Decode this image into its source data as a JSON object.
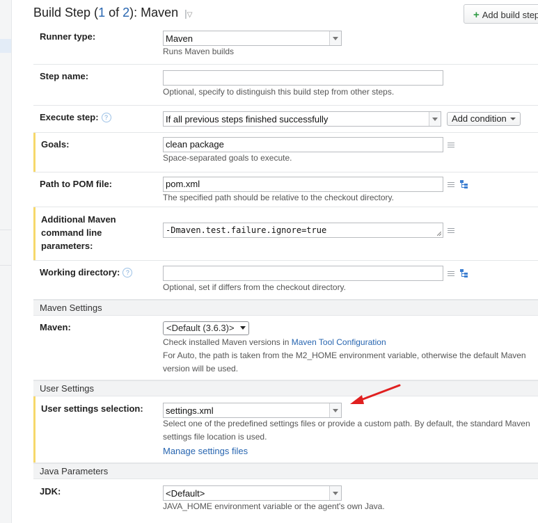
{
  "header": {
    "title_prefix": "Build Step (",
    "step_current": "1",
    "title_of": " of ",
    "step_total": "2",
    "title_suffix": "): Maven",
    "separator": "|",
    "dropdown_glyph": "▽",
    "add_button_label": "Add build step"
  },
  "colors": {
    "link": "#2765b0",
    "highlight_bar": "#f6d86b",
    "annotation_arrow": "#e02020"
  },
  "fields": {
    "runner_type": {
      "label": "Runner type:",
      "value": "Maven",
      "note": "Runs Maven builds"
    },
    "step_name": {
      "label": "Step name:",
      "value": "",
      "note": "Optional, specify to distinguish this build step from other steps."
    },
    "execute_step": {
      "label": "Execute step:",
      "value": "If all previous steps finished successfully",
      "condition_button": "Add condition"
    },
    "goals": {
      "label": "Goals:",
      "value": "clean package",
      "note": "Space-separated goals to execute."
    },
    "pom_path": {
      "label": "Path to POM file:",
      "value": "pom.xml",
      "note": "The specified path should be relative to the checkout directory."
    },
    "additional_params": {
      "label_line1": "Additional Maven",
      "label_line2": "command line",
      "label_line3": "parameters:",
      "value": "-Dmaven.test.failure.ignore=true"
    },
    "working_dir": {
      "label": "Working directory:",
      "value": "",
      "note": "Optional, set if differs from the checkout directory."
    }
  },
  "maven_settings": {
    "section_title": "Maven Settings",
    "maven": {
      "label": "Maven:",
      "value": "<Default (3.6.3)>",
      "note_prefix": "Check installed Maven versions in ",
      "note_link": "Maven Tool Configuration",
      "note2_line1": "For Auto, the path is taken from the M2_HOME environment variable, otherwise the default Maven",
      "note2_line2": "version will be used."
    }
  },
  "user_settings": {
    "section_title": "User Settings",
    "selection": {
      "label": "User settings selection:",
      "value": "settings.xml",
      "note_line1": "Select one of the predefined settings files or provide a custom path. By default, the standard Maven",
      "note_line2": "settings file location is used.",
      "manage_link": "Manage settings files"
    }
  },
  "java_params": {
    "section_title": "Java Parameters",
    "jdk": {
      "label": "JDK:",
      "value": "<Default>",
      "note": "JAVA_HOME environment variable or the agent's own Java."
    }
  }
}
